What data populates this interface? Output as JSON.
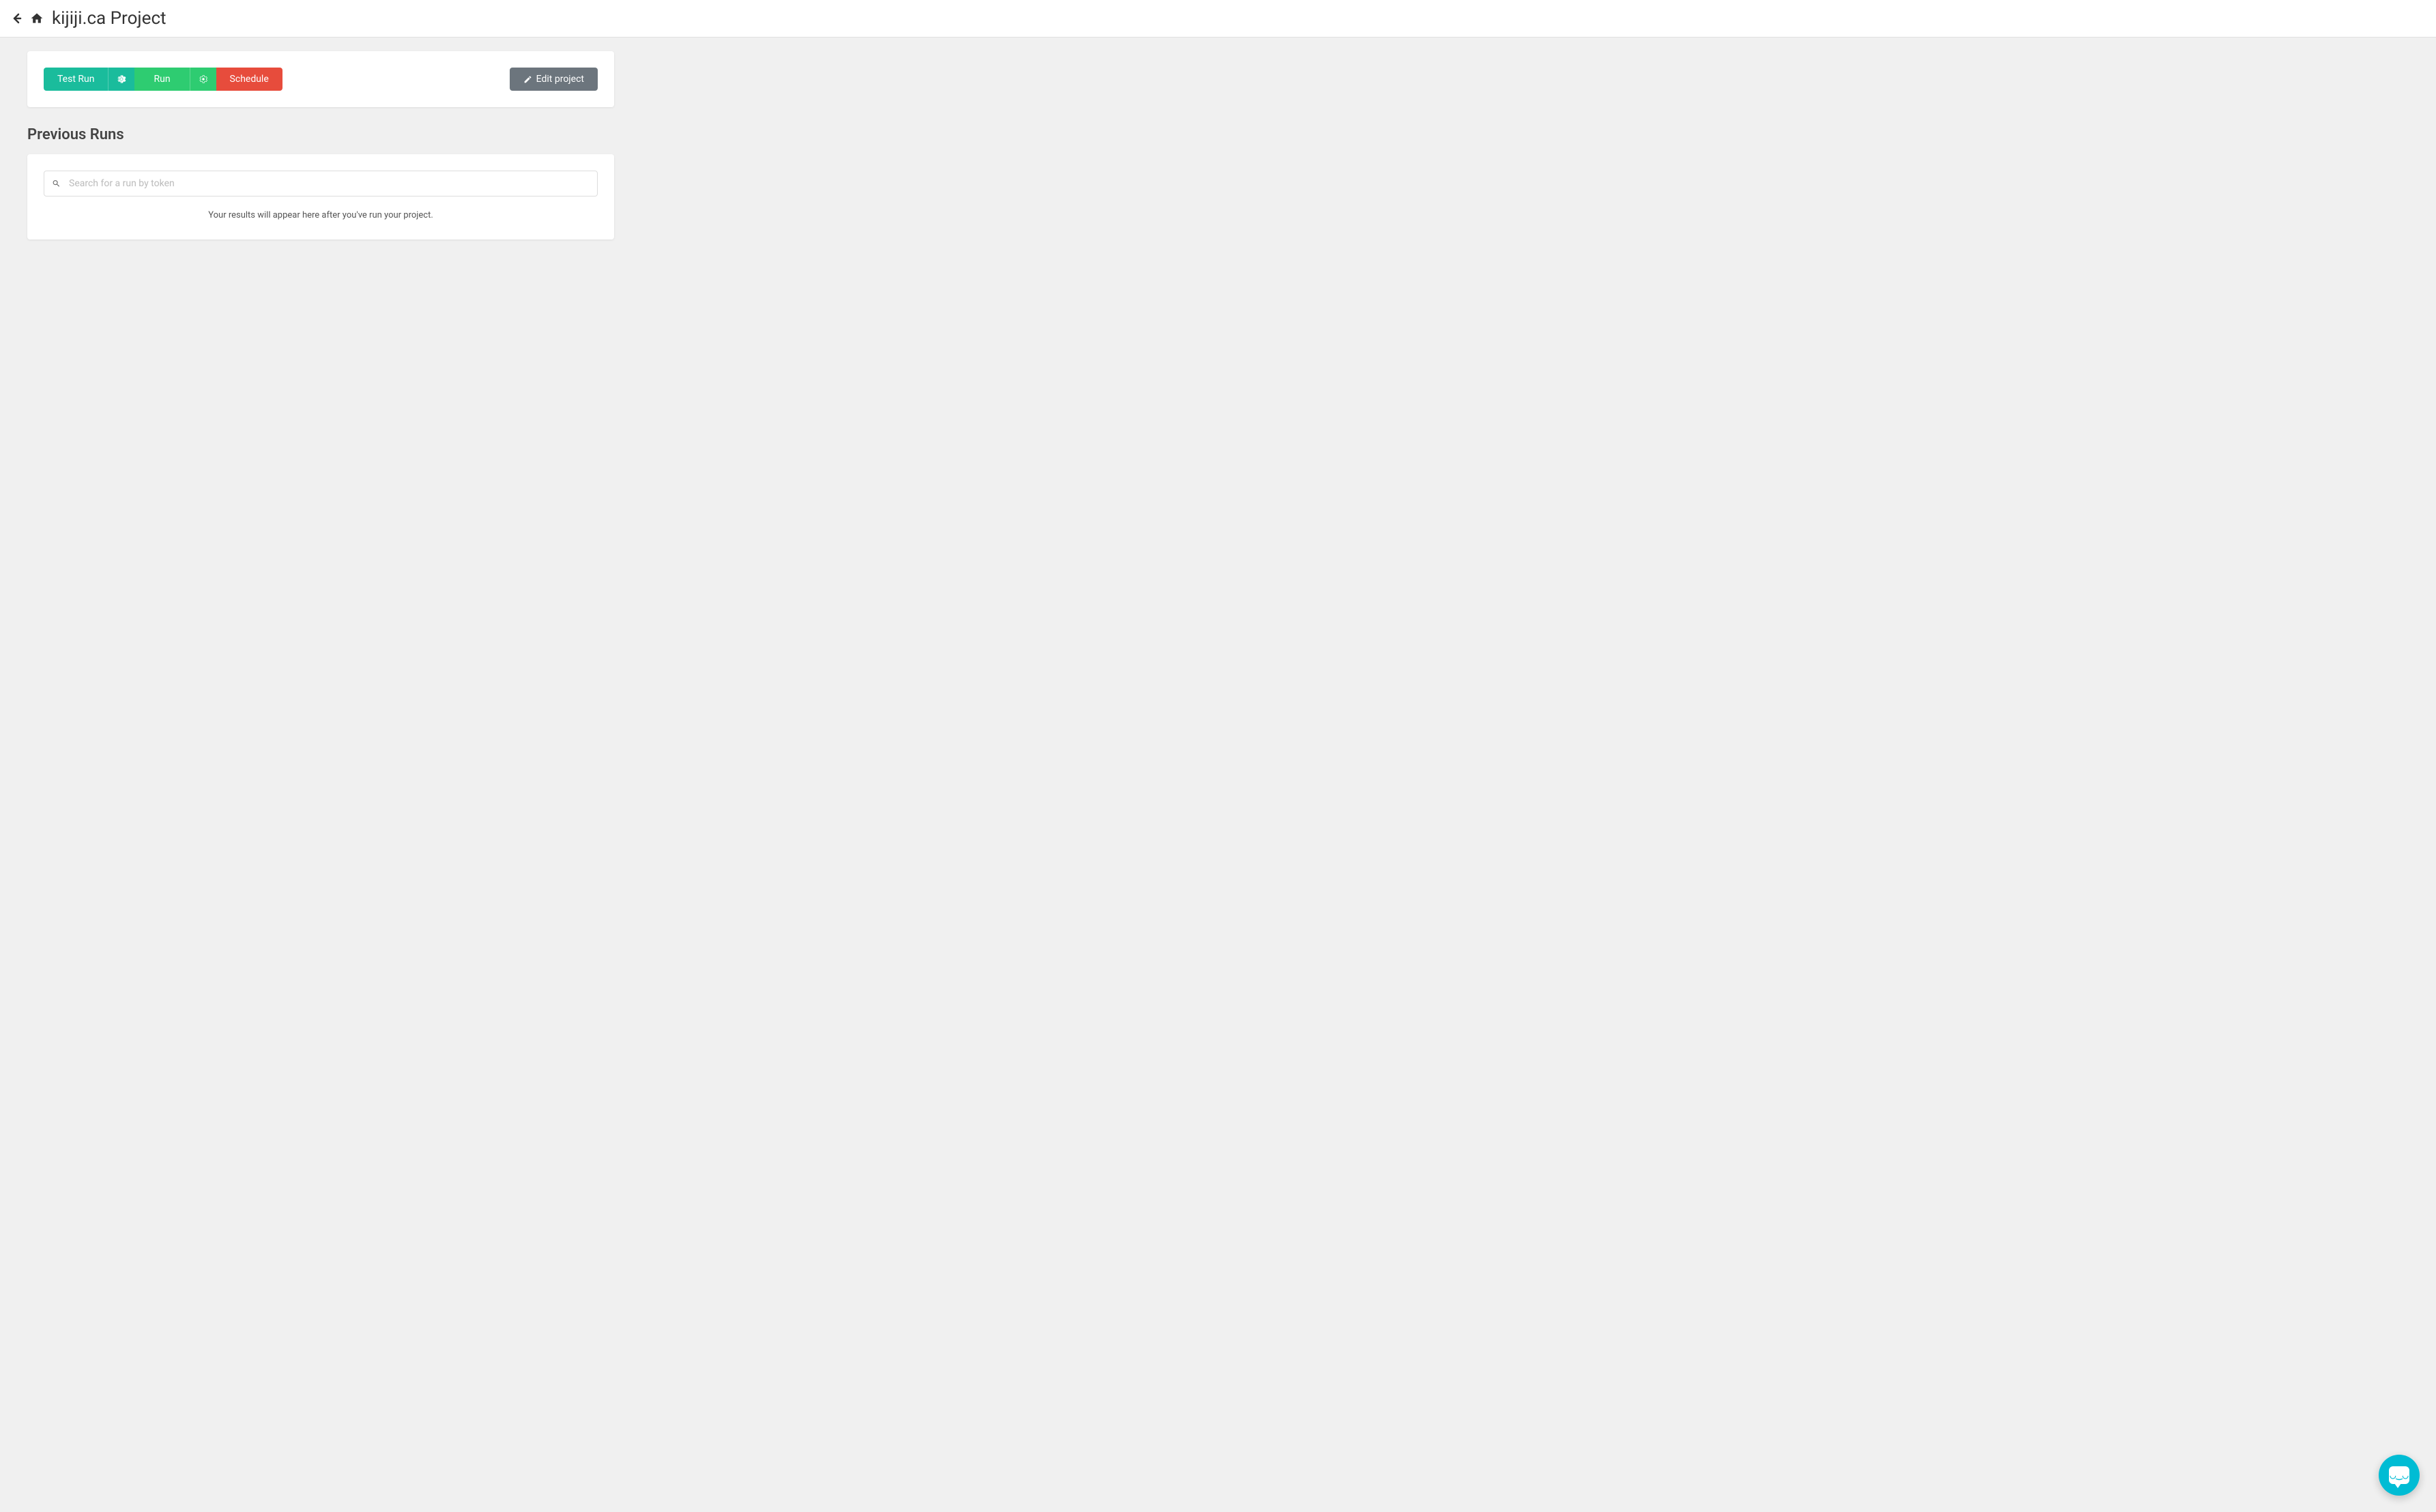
{
  "header": {
    "title": "kijiji.ca Project"
  },
  "toolbar": {
    "test_run_label": "Test Run",
    "run_label": "Run",
    "schedule_label": "Schedule",
    "edit_project_label": "Edit project"
  },
  "previous_runs": {
    "section_title": "Previous Runs",
    "search_placeholder": "Search for a run by token",
    "empty_message": "Your results will appear here after you've run your project."
  },
  "colors": {
    "teal": "#1abc9c",
    "green": "#2ecc71",
    "red": "#e74c3c",
    "gray": "#6c757d",
    "chat": "#00bcd4"
  }
}
